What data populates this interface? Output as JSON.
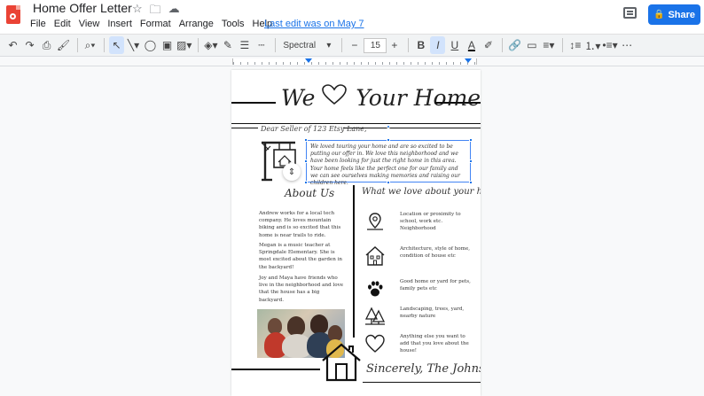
{
  "app": {
    "doc_title": "Home Offer Letter",
    "menu": [
      "File",
      "Edit",
      "View",
      "Insert",
      "Format",
      "Arrange",
      "Tools",
      "Help"
    ],
    "last_edit": "Last edit was on May 7",
    "share_label": "Share"
  },
  "toolbar": {
    "font": "Spectral",
    "font_size": "15",
    "minus": "−",
    "plus": "+",
    "bold": "B",
    "italic": "I",
    "underline": "U",
    "text_color": "A"
  },
  "document": {
    "header_left": "We",
    "header_right": "Your Home",
    "dear": "Dear Seller of  123 Etsy Lane,",
    "intro": "We loved touring your home and are so excited to be putting our offer in. We love this neighborhood and we have been looking for just the right home in this area. Your home feels like the perfect one for our family and we can see ourselves making memories and raising our children here.",
    "about_title": "About Us",
    "love_title": "What we love about your home:",
    "about_paras": [
      "Andrew works for a local tech company. He loves mountain biking and is so excited that this home is near trails to ride.",
      "Megan is a music teacher at Springdale Elementary. She is most excited about the garden in the backyard!",
      "Joy and Maya have friends who live in the neighborhood and love that the house has a big backyard."
    ],
    "love_items": [
      {
        "icon": "location-pin-icon",
        "text": "Location or proximity to school, work etc. Neighborhood"
      },
      {
        "icon": "house-outline-icon",
        "text": "Architecture, style of home, condition of house etc"
      },
      {
        "icon": "paw-print-icon",
        "text": "Good home or yard for pets, family pets etc"
      },
      {
        "icon": "trees-icon",
        "text": "Landscaping, trees, yard, nearby nature"
      },
      {
        "icon": "heart-outline-icon",
        "text": "Anything else you want to add that you love about the house!"
      }
    ],
    "signoff": "Sincerely, The Johnsons"
  },
  "colors": {
    "share_blue": "#1a73e8",
    "doc_icon_red": "#ea4335",
    "selection_blue": "#4285f4"
  }
}
